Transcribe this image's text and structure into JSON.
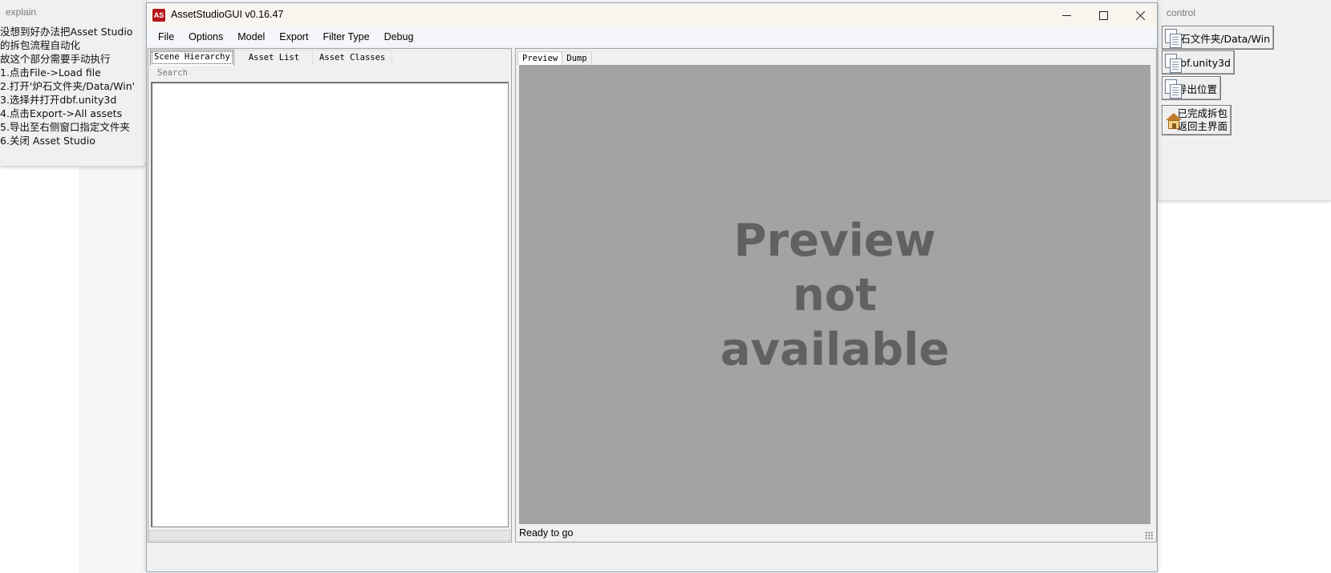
{
  "explain": {
    "title": "explain",
    "lines": [
      "没想到好办法把Asset Studio",
      "的拆包流程自动化",
      "故这个部分需要手动执行",
      "1.点击File->Load file",
      "2.打开'炉石文件夹/Data/Win'",
      "3.选择并打开dbf.unity3d",
      "4.点击Export->All assets",
      "5.导出至右侧窗口指定文件夹",
      "6.关闭 Asset Studio"
    ]
  },
  "control": {
    "title": "control",
    "buttons": [
      {
        "label": "炉石文件夹/Data/Win",
        "icon": "documents-icon"
      },
      {
        "label": "dbf.unity3d",
        "icon": "documents-icon"
      },
      {
        "label": "导出位置",
        "icon": "documents-icon"
      },
      {
        "label": "已完成拆包\n返回主界面",
        "icon": "house-icon"
      }
    ]
  },
  "app": {
    "logo_text": "AS",
    "title": "AssetStudioGUI v0.16.47",
    "menu": [
      "File",
      "Options",
      "Model",
      "Export",
      "Filter Type",
      "Debug"
    ],
    "left_tabs": [
      "Scene Hierarchy",
      "Asset List",
      "Asset Classes"
    ],
    "active_left_tab": "Scene Hierarchy",
    "search_placeholder": "Search",
    "right_tabs": [
      "Preview",
      "Dump"
    ],
    "active_right_tab": "Preview",
    "preview_text": [
      "Preview",
      "not",
      "available"
    ],
    "status": "Ready to go"
  },
  "colors": {
    "preview_bg": "#a3a3a3",
    "preview_text": "#616161",
    "logo": "#b5141c"
  }
}
